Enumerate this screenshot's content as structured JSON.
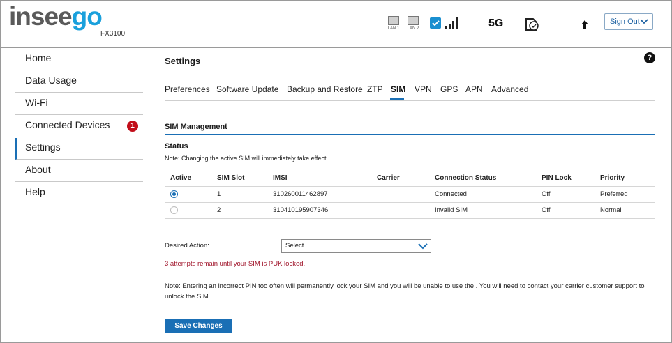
{
  "header": {
    "logo_text_a": "insee",
    "logo_text_b": "go",
    "model": "FX3100",
    "lan1_label": "LAN 1",
    "lan2_label": "LAN 2",
    "network_label": "5G",
    "sign_out_label": "Sign Out",
    "accent_color": "#1a6fb5",
    "icons": [
      "ethernet-port-icon",
      "ethernet-port-icon",
      "wifi-status-icon",
      "signal-strength-icon",
      "sim-check-icon",
      "upload-arrow-icon",
      "chevron-down-icon"
    ]
  },
  "sidebar": {
    "items": [
      {
        "label": "Home"
      },
      {
        "label": "Data Usage"
      },
      {
        "label": "Wi-Fi"
      },
      {
        "label": "Connected Devices",
        "badge": "1"
      },
      {
        "label": "Settings",
        "active": true
      },
      {
        "label": "About"
      },
      {
        "label": "Help"
      }
    ]
  },
  "main": {
    "title": "Settings",
    "help_label": "?",
    "tabs": [
      "Preferences",
      "Software Update",
      "Backup and Restore",
      "ZTP",
      "SIM",
      "VPN",
      "GPS",
      "APN",
      "Advanced"
    ],
    "active_tab": "SIM",
    "section_title": "SIM Management",
    "status_heading": "Status",
    "status_note": "Note: Changing the active SIM will immediately take effect.",
    "table": {
      "headers": [
        "Active",
        "SIM Slot",
        "IMSI",
        "Carrier",
        "Connection Status",
        "PIN Lock",
        "Priority"
      ],
      "rows": [
        {
          "active": true,
          "slot": "1",
          "imsi": "310260011462897",
          "carrier": "",
          "connection_status": "Connected",
          "pin_lock": "Off",
          "priority": "Preferred"
        },
        {
          "active": false,
          "slot": "2",
          "imsi": "310410195907346",
          "carrier": "",
          "connection_status": "Invalid SIM",
          "pin_lock": "Off",
          "priority": "Normal"
        }
      ]
    },
    "desired_action_label": "Desired Action:",
    "desired_action_value": "Select",
    "puk_warning": "3 attempts remain until your SIM is PUK locked.",
    "pin_note": "Note: Entering an incorrect PIN too often will permanently lock your SIM and you will be unable to use the . You will need to contact your carrier customer support to unlock the SIM.",
    "save_label": "Save Changes",
    "warning_color": "#a0142a"
  }
}
